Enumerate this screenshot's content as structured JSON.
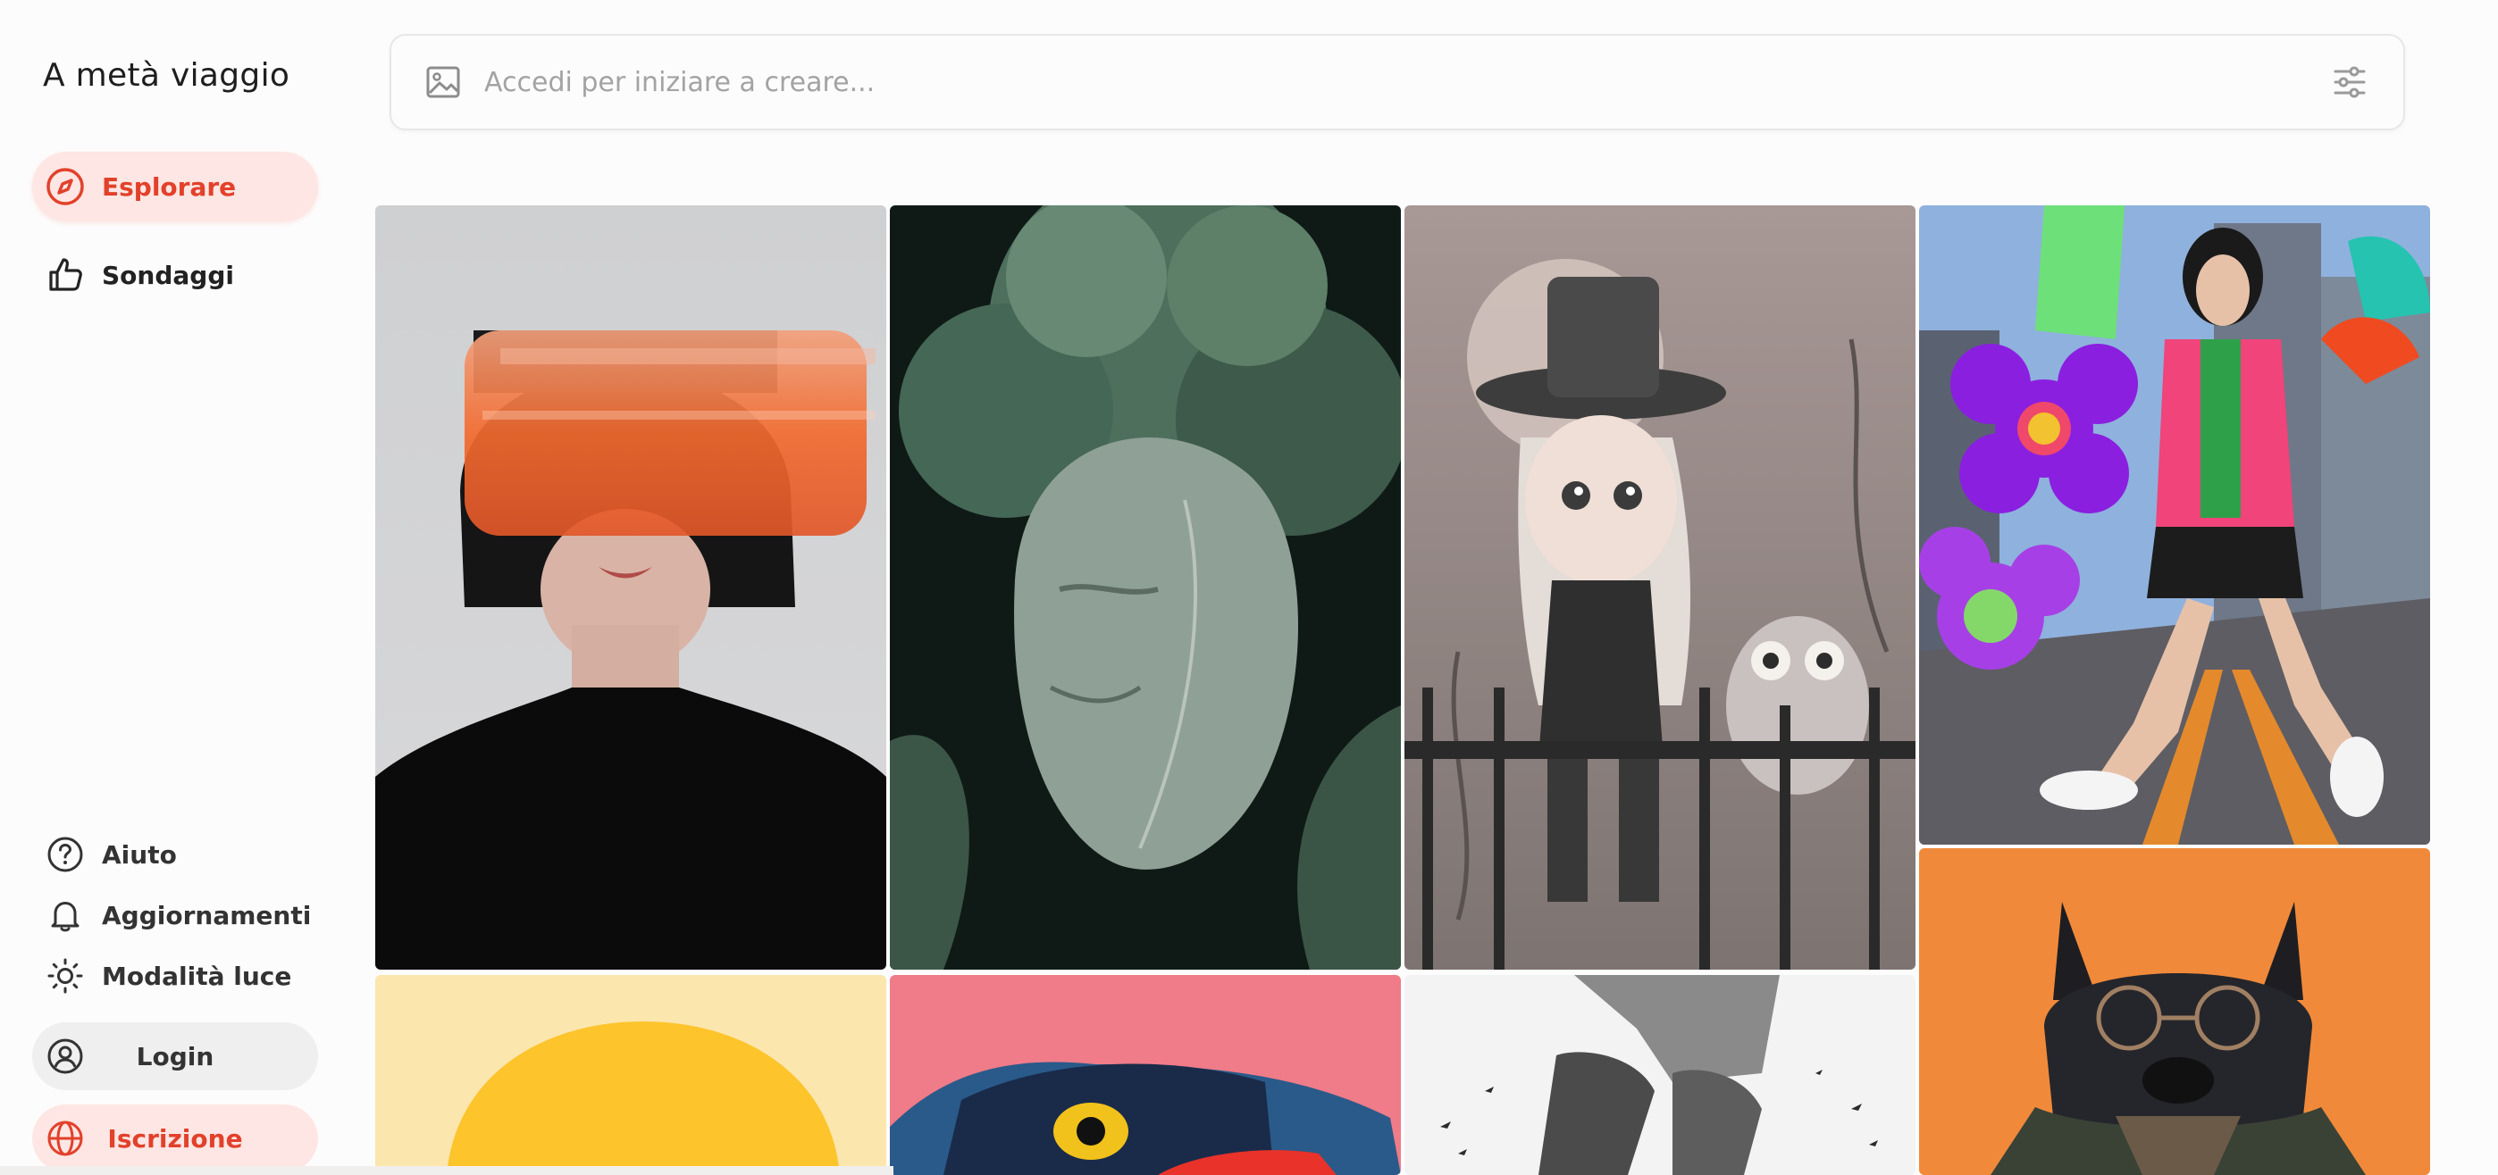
{
  "sidebar": {
    "brand": "A metà viaggio",
    "nav": [
      {
        "label": "Esplorare",
        "icon": "compass-icon",
        "active": true
      },
      {
        "label": "Sondaggi",
        "icon": "thumbs-up-icon",
        "active": false
      }
    ],
    "bottom": [
      {
        "label": "Aiuto",
        "icon": "help-circle-icon"
      },
      {
        "label": "Aggiornamenti",
        "icon": "bell-icon"
      },
      {
        "label": "Modalità luce",
        "icon": "sun-icon"
      }
    ],
    "login_label": "Login",
    "signup_label": "Iscrizione"
  },
  "search": {
    "placeholder": "Accedi per iniziare a creare..."
  },
  "gallery": [
    {
      "name": "woman-orange-blur"
    },
    {
      "name": "cabbage-face-sculpture"
    },
    {
      "name": "girl-top-hat-owl"
    },
    {
      "name": "woman-pink-blazer-street"
    },
    {
      "name": "yellow-sun"
    },
    {
      "name": "panther-pink"
    },
    {
      "name": "boots-walking-bw"
    },
    {
      "name": "black-dog-glasses"
    }
  ],
  "colors": {
    "accent": "#e2412b",
    "accent_bg": "#fde6e3",
    "background": "#fdfcfc"
  }
}
